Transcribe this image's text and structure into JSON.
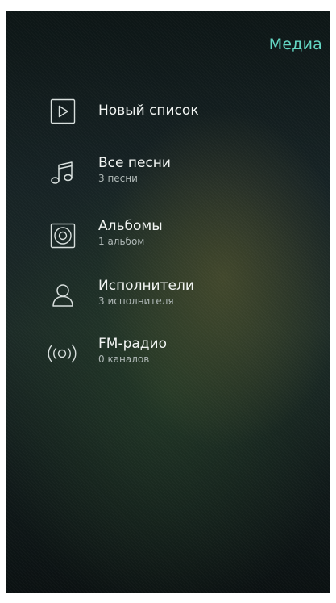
{
  "header": {
    "action_label": "Медиа"
  },
  "menu": {
    "items": [
      {
        "icon": "play-icon",
        "label": "Новый список",
        "subtitle": ""
      },
      {
        "icon": "music-note-icon",
        "label": "Все песни",
        "subtitle": "3 песни"
      },
      {
        "icon": "album-icon",
        "label": "Альбомы",
        "subtitle": "1 альбом"
      },
      {
        "icon": "person-icon",
        "label": "Исполнители",
        "subtitle": "3 исполнителя"
      },
      {
        "icon": "radio-icon",
        "label": "FM-радио",
        "subtitle": "0 каналов"
      }
    ]
  },
  "colors": {
    "accent": "#64d7c4",
    "text_primary": "#f1f4f2",
    "text_secondary": "#aeb7b5"
  }
}
